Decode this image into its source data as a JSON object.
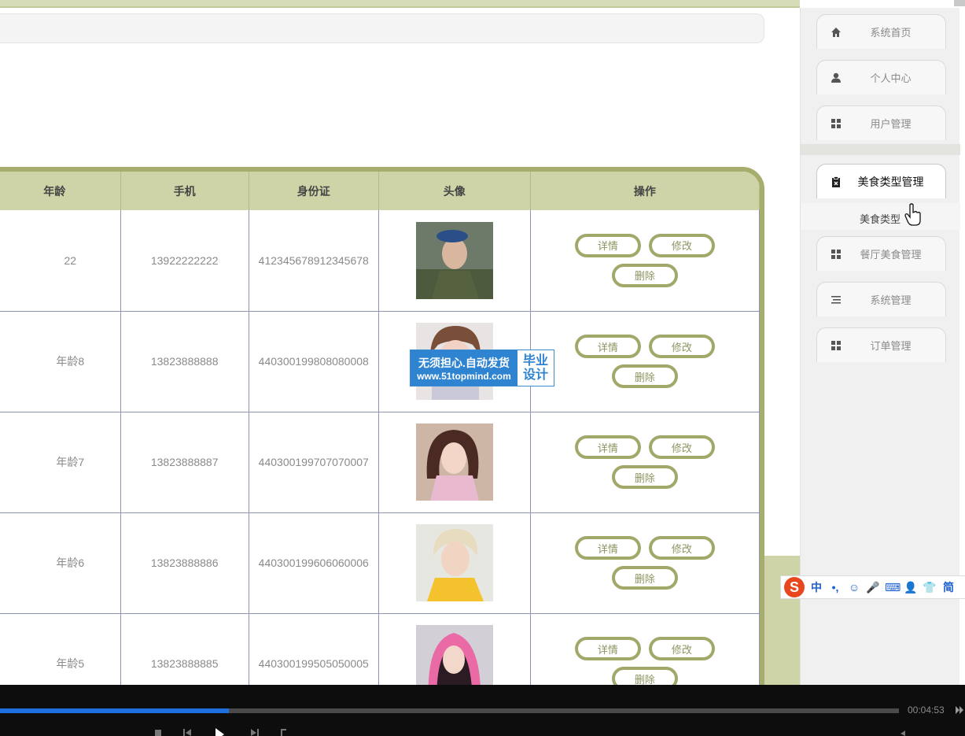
{
  "table": {
    "columns": [
      "年龄",
      "手机",
      "身份证",
      "头像",
      "操作"
    ],
    "rows": [
      {
        "age": "22",
        "phone": "13922222222",
        "id_card": "412345678912345678"
      },
      {
        "age": "年龄8",
        "phone": "13823888888",
        "id_card": "440300199808080008"
      },
      {
        "age": "年龄7",
        "phone": "13823888887",
        "id_card": "440300199707070007"
      },
      {
        "age": "年龄6",
        "phone": "13823888886",
        "id_card": "440300199606060006"
      },
      {
        "age": "年龄5",
        "phone": "13823888885",
        "id_card": "440300199505050005"
      }
    ],
    "actions": {
      "detail": "详情",
      "edit": "修改",
      "delete": "删除"
    }
  },
  "sidebar": {
    "items": [
      {
        "label": "系统首页",
        "icon": "home-icon"
      },
      {
        "label": "个人中心",
        "icon": "person-icon"
      },
      {
        "label": "用户管理",
        "icon": "grid-icon"
      },
      {
        "label": "美食类型管理",
        "icon": "clipboard-icon"
      },
      {
        "label": "餐厅美食管理",
        "icon": "grid-icon"
      },
      {
        "label": "系统管理",
        "icon": "list-icon"
      },
      {
        "label": "订单管理",
        "icon": "grid-icon"
      }
    ],
    "active_index": 3,
    "sub_item": "美食类型"
  },
  "watermark": {
    "line1": "无须担心.自动发货",
    "line2": "www.51topmind.com",
    "side_top": "毕业",
    "side_bottom": "设计"
  },
  "ime": {
    "logo": "S",
    "glyphs": [
      "中",
      "•,",
      "☺",
      "🎤",
      "⌨",
      "👤",
      "👕",
      "简"
    ]
  },
  "player": {
    "time": "00:04:53",
    "progress": 0.255
  },
  "colors": {
    "accent": "#a6ad6d",
    "header_bg": "#cfd4a8",
    "progress": "#1e6fe0"
  }
}
